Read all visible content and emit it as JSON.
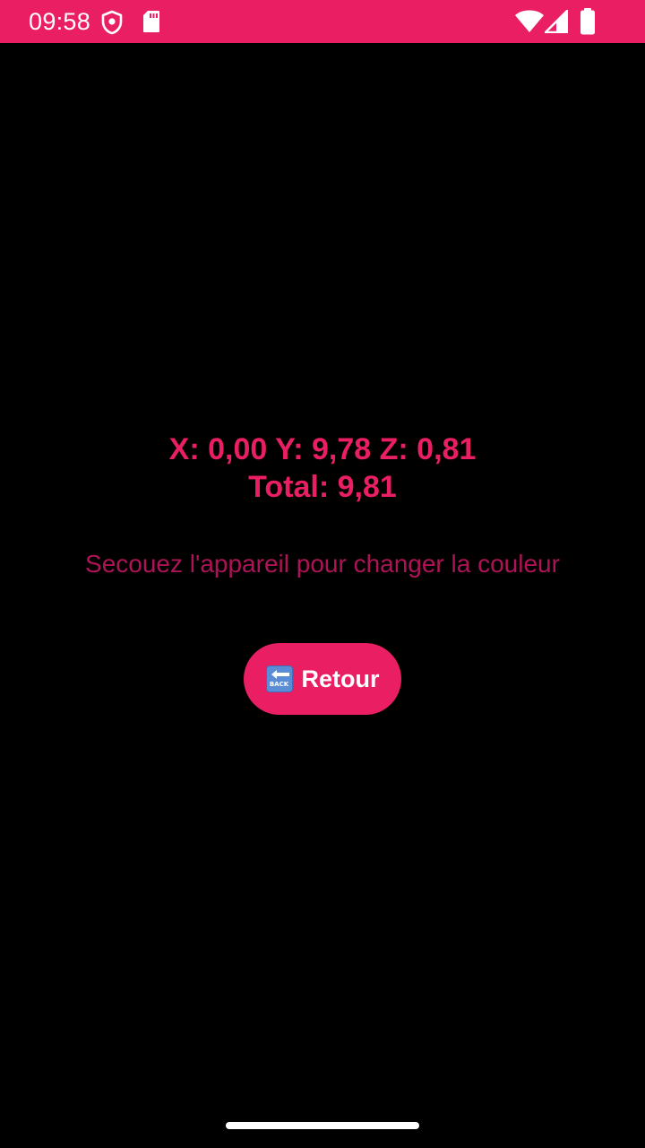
{
  "status_bar": {
    "time": "09:58",
    "left_icons": [
      "shield-icon",
      "sd-card-icon"
    ],
    "right_icons": [
      "wifi-icon",
      "cellular-signal-icon",
      "battery-icon"
    ],
    "color": "#E91E63"
  },
  "sensor": {
    "readings_xyz": "X: 0,00 Y: 9,78 Z: 0,81",
    "total": "Total: 9,81"
  },
  "hint": "Secouez l'appareil pour changer la couleur",
  "back_button": {
    "emoji_text": "BACK",
    "label": "Retour"
  },
  "colors": {
    "accent": "#E91E63",
    "hint": "#AD1457",
    "background": "#000000"
  }
}
